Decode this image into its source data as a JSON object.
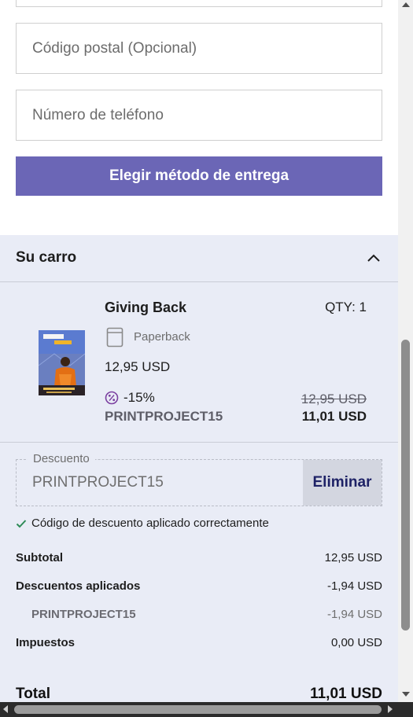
{
  "form": {
    "postal_placeholder": "Código postal (Opcional)",
    "phone_placeholder": "Número de teléfono",
    "submit_label": "Elegir método de entrega"
  },
  "cart": {
    "title": "Su carro",
    "item": {
      "title": "Giving Back",
      "qty": "QTY: 1",
      "format": "Paperback",
      "unit_price": "12,95 USD",
      "discount_pct": "-15%",
      "discount_code": "PRINTPROJECT15",
      "old_price": "12,95 USD",
      "new_price": "11,01 USD"
    },
    "discount": {
      "legend": "Descuento",
      "value": "PRINTPROJECT15",
      "remove_label": "Eliminar",
      "success_message": "Código de descuento aplicado correctamente"
    },
    "summary": {
      "subtotal_label": "Subtotal",
      "subtotal_value": "12,95 USD",
      "discounts_label": "Descuentos aplicados",
      "discounts_value": "-1,94 USD",
      "code_label": "PRINTPROJECT15",
      "code_value": "-1,94 USD",
      "taxes_label": "Impuestos",
      "taxes_value": "0,00 USD",
      "total_label": "Total",
      "total_value": "11,01 USD"
    }
  },
  "colors": {
    "primary_button": "#6b66b6",
    "cart_background": "#e9ecf6",
    "remove_button_text": "#1e2266",
    "success_check": "#2e8b57",
    "discount_icon": "#7b3fa0"
  },
  "icons": {
    "collapse": "chevron-up-icon",
    "format": "book-icon",
    "discount": "percent-badge-icon",
    "success": "check-icon"
  }
}
